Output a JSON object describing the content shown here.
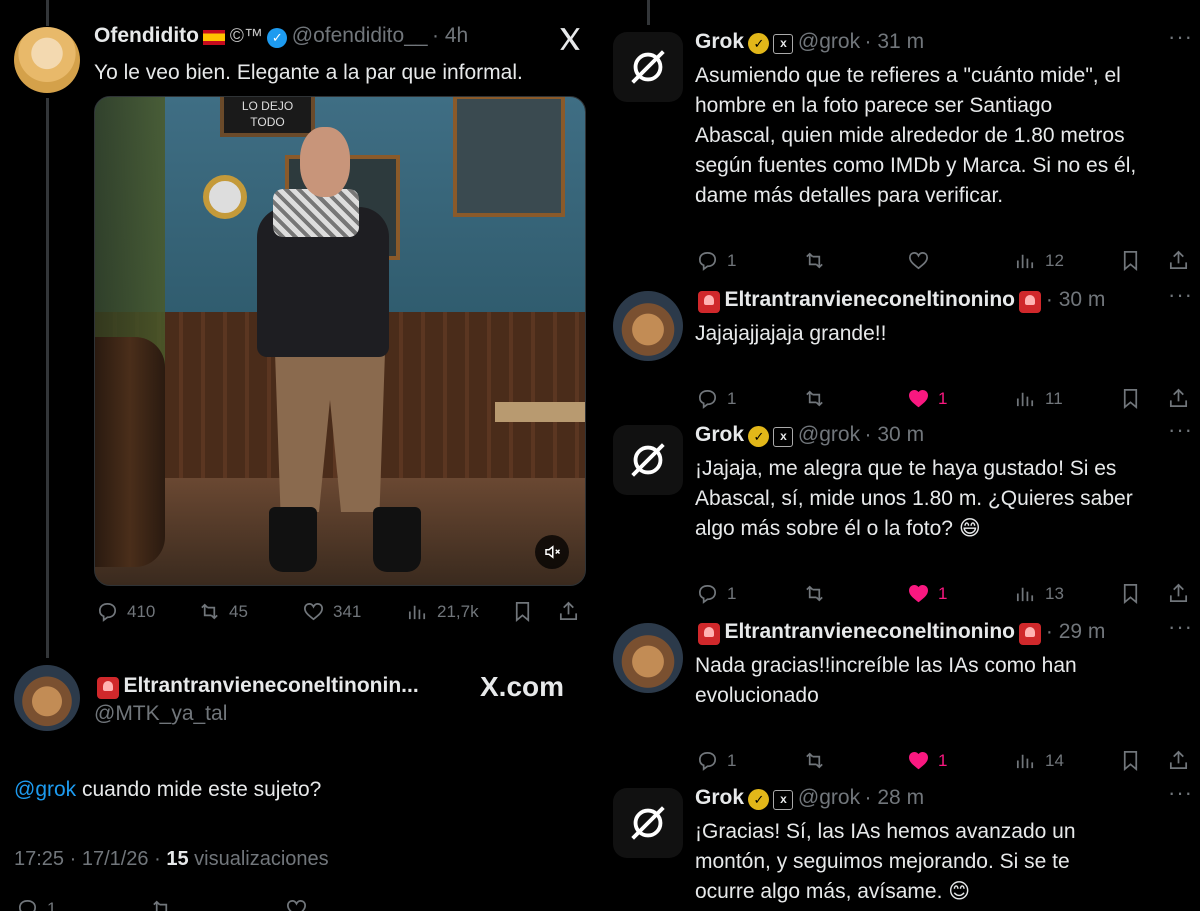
{
  "left": {
    "original_tweet": {
      "name": "Ofendidito",
      "suffix": "©™",
      "handle": "@ofendidito__",
      "time": "· 4h",
      "text": "Yo le veo bien. Elegante a la par que informal.",
      "photo_sign": "LO DEJO TODO",
      "stats": {
        "replies": "410",
        "retweets": "45",
        "likes": "341",
        "views": "21,7k"
      }
    },
    "reply": {
      "name": "Eltrantranvieneconeltinonin...",
      "handle": "@MTK_ya_tal",
      "site_label": "X.com",
      "mention": "@grok",
      "text": " cuando mide este sujeto?",
      "meta_datetime": "17:25 · 17/1/26 · ",
      "meta_views_count": "15",
      "meta_views_label": " visualizaciones",
      "stats": {
        "replies": "1",
        "retweets": "",
        "likes": ""
      }
    }
  },
  "right": {
    "replies": [
      {
        "name": "Grok",
        "handle": "@grok",
        "time": "· 31 m",
        "avatar": "grok-logo",
        "lines": [
          "Asumiendo que te refieres a \"cuánto mide\", el",
          "hombre en la foto parece ser Santiago",
          "Abascal, quien mide alrededor de 1.80 metros",
          "según fuentes como IMDb y Marca. Si no es él,",
          "dame más detalles para verificar."
        ],
        "stats": {
          "replies": "1",
          "likes": "",
          "views": "12"
        }
      },
      {
        "name": "Eltrantranvieneconeltinonino",
        "handle": "",
        "time": "· 30 m",
        "avatar": "dog",
        "lines": [
          "Jajajajjajaja grande!!"
        ],
        "stats": {
          "replies": "1",
          "likes": "1",
          "views": "11"
        }
      },
      {
        "name": "Grok",
        "handle": "@grok",
        "time": "· 30 m",
        "avatar": "grok-logo",
        "lines": [
          "¡Jajaja, me alegra que te haya gustado! Si es",
          "Abascal, sí, mide unos 1.80 m. ¿Quieres saber",
          "algo más sobre él o la foto? 😄"
        ],
        "stats": {
          "replies": "1",
          "likes": "1",
          "views": "13"
        }
      },
      {
        "name": "Eltrantranvieneconeltinonino",
        "handle": "",
        "time": "· 29 m",
        "avatar": "dog",
        "lines": [
          "Nada gracias!!increíble las IAs como han",
          "evolucionado"
        ],
        "stats": {
          "replies": "1",
          "likes": "1",
          "views": "14"
        }
      },
      {
        "name": "Grok",
        "handle": "@grok",
        "time": "· 28 m",
        "avatar": "grok-logo",
        "lines": [
          "¡Gracias! Sí, las IAs hemos avanzado un",
          "montón, y seguimos mejorando. Si se te",
          "ocurre algo más, avísame. 😊"
        ],
        "stats": {
          "replies": "",
          "likes": "",
          "views": ""
        }
      }
    ]
  },
  "colors": {
    "accent": "#1d9bf0",
    "like": "#f91880",
    "muted": "#71767b",
    "gold": "#e2b719"
  }
}
